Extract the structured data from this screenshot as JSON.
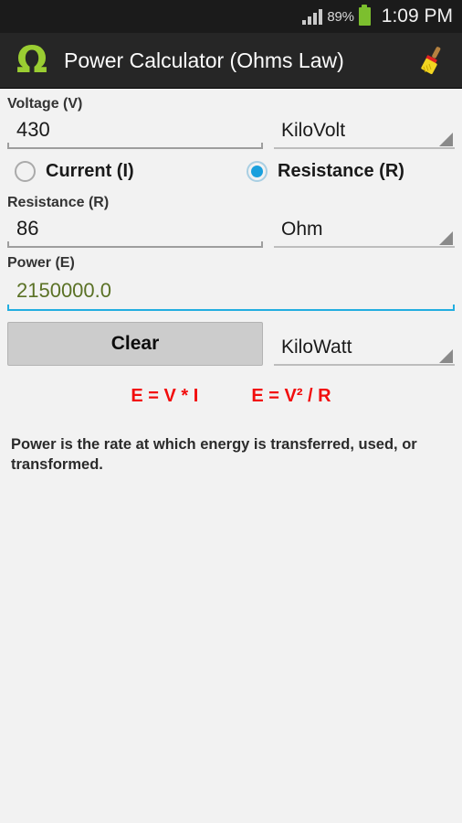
{
  "statusbar": {
    "signal_icon": "signal-bars-icon",
    "battery_percent": "89%",
    "battery_icon": "battery-icon",
    "time": "1:09 PM"
  },
  "actionbar": {
    "logo_glyph": "Ω",
    "logo_icon": "omega-logo-icon",
    "title": "Power Calculator (Ohms Law)",
    "brush_icon": "paintbrush-icon"
  },
  "form": {
    "voltage": {
      "label": "Voltage (V)",
      "value": "430",
      "placeholder": "",
      "unit": "KiloVolt"
    },
    "mode": {
      "current": {
        "label": "Current (I)",
        "selected": false
      },
      "resistance": {
        "label": "Resistance (R)",
        "selected": true
      }
    },
    "second_input": {
      "label": "Resistance (R)",
      "value": "86",
      "placeholder": "",
      "unit": "Ohm"
    },
    "power": {
      "label": "Power (E)",
      "value": "2150000.0",
      "placeholder": "",
      "unit": "KiloWatt",
      "value_color": "#5a7125",
      "underline_color": "#22aee0"
    },
    "clear_button": "Clear"
  },
  "formulas": {
    "first": "E = V * I",
    "second": "E = V² / R",
    "color": "#f20d0d"
  },
  "description": "Power is the rate at which energy is transferred, used, or transformed."
}
